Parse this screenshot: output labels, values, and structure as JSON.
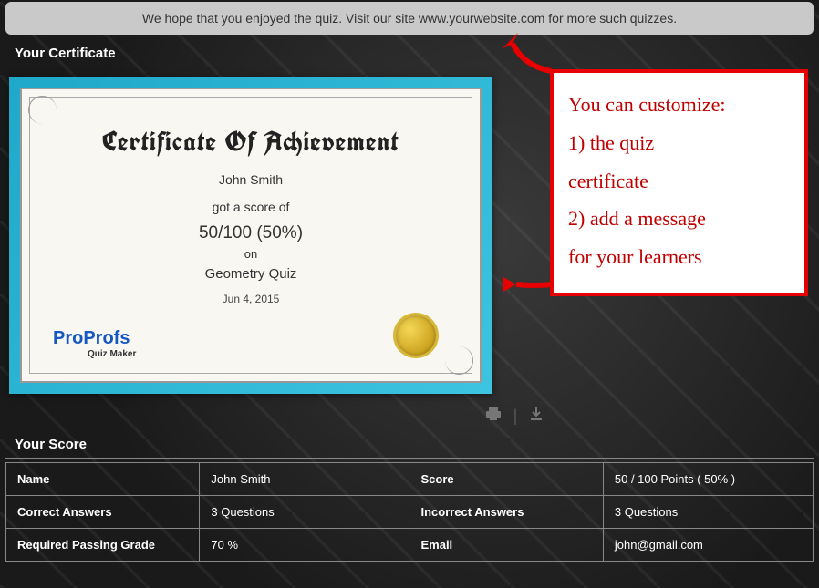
{
  "banner": "We hope that you enjoyed the quiz. Visit our site www.yourwebsite.com for more such quizzes.",
  "sections": {
    "certificate_title": "Your Certificate",
    "score_title": "Your Score"
  },
  "certificate": {
    "heading": "Certificate Of Achievement",
    "name": "John Smith",
    "got_score": "got a score of",
    "score_line": "50/100 (50%)",
    "on": "on",
    "quiz_name": "Geometry Quiz",
    "date": "Jun 4, 2015",
    "logo_pro": "Pro",
    "logo_profs": "Profs",
    "logo_sub": "Quiz Maker"
  },
  "callout": {
    "line1": "You can customize:",
    "line2": "1) the quiz",
    "line3": "certificate",
    "line4": "2) add a message",
    "line5": "for your learners"
  },
  "score": {
    "rows": [
      {
        "l1": "Name",
        "v1": "John Smith",
        "l2": "Score",
        "v2": "50 / 100    Points ( 50% )"
      },
      {
        "l1": "Correct Answers",
        "v1": "3 Questions",
        "l2": "Incorrect Answers",
        "v2": "3 Questions"
      },
      {
        "l1": "Required Passing Grade",
        "v1": "70 %",
        "l2": "Email",
        "v2": "john@gmail.com"
      }
    ]
  }
}
